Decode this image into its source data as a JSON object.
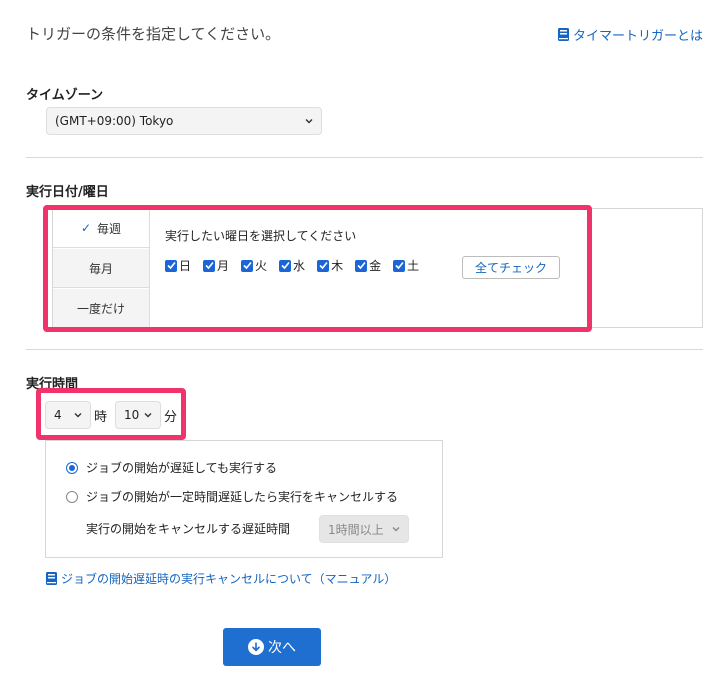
{
  "header": {
    "instruction": "トリガーの条件を指定してください。",
    "help_link": "タイマートリガーとは"
  },
  "timezone": {
    "label": "タイムゾーン",
    "selected": "(GMT+09:00) Tokyo"
  },
  "schedule": {
    "label": "実行日付/曜日",
    "tabs": [
      {
        "label": "毎週",
        "active": true
      },
      {
        "label": "毎月",
        "active": false
      },
      {
        "label": "一度だけ",
        "active": false
      }
    ],
    "weekday_prompt": "実行したい曜日を選択してください",
    "weekdays": [
      {
        "label": "日",
        "checked": true
      },
      {
        "label": "月",
        "checked": true
      },
      {
        "label": "火",
        "checked": true
      },
      {
        "label": "水",
        "checked": true
      },
      {
        "label": "木",
        "checked": true
      },
      {
        "label": "金",
        "checked": true
      },
      {
        "label": "土",
        "checked": true
      }
    ],
    "check_all_button": "全てチェック"
  },
  "exec_time": {
    "label": "実行時間",
    "hour": "4",
    "hour_unit": "時",
    "minute": "10",
    "minute_unit": "分"
  },
  "delay_options": {
    "option_run": "ジョブの開始が遅延しても実行する",
    "option_cancel": "ジョブの開始が一定時間遅延したら実行をキャンセルする",
    "cancel_delay_label": "実行の開始をキャンセルする遅延時間",
    "cancel_delay_value": "1時間以上"
  },
  "manual_link": "ジョブの開始遅延時の実行キャンセルについて（マニュアル）",
  "next_button": "次へ",
  "colors": {
    "accent": "#1e6fcf",
    "highlight": "#f0336b",
    "link": "#1565c0"
  }
}
